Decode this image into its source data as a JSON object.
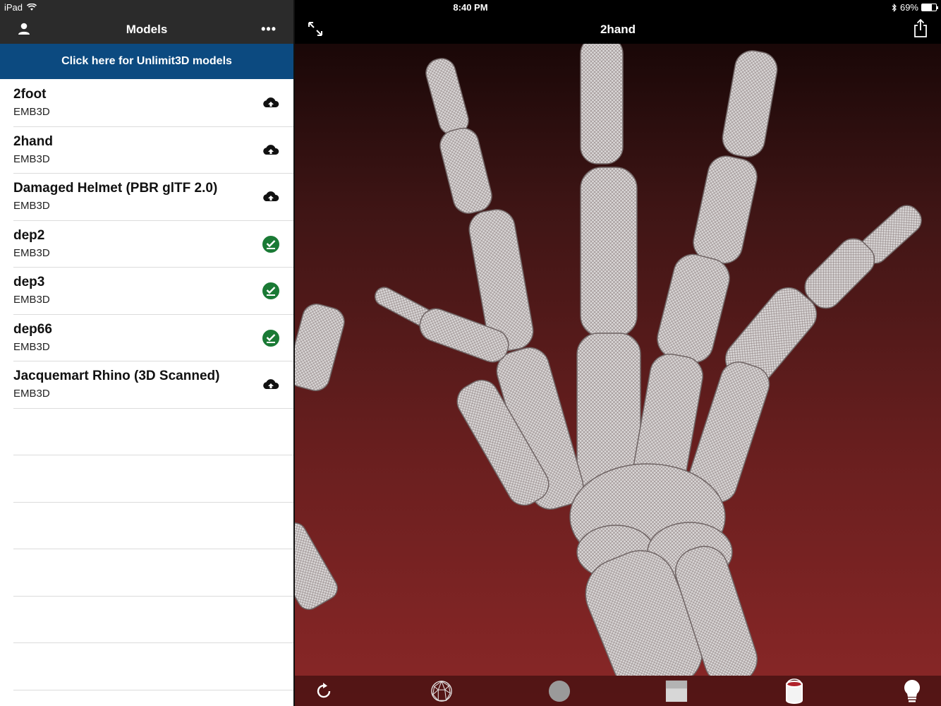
{
  "status_bar": {
    "device": "iPad",
    "time": "8:40 PM",
    "battery_label": "69%",
    "battery_level": 0.69
  },
  "left_nav": {
    "title": "Models",
    "more_label": "•••"
  },
  "promo_banner": {
    "label": "Click here for Unlimit3D models"
  },
  "models": [
    {
      "name": "2foot",
      "format": "EMB3D",
      "status": "cloud-upload-icon"
    },
    {
      "name": "2hand",
      "format": "EMB3D",
      "status": "cloud-upload-icon"
    },
    {
      "name": "Damaged Helmet (PBR glTF 2.0)",
      "format": "EMB3D",
      "status": "cloud-upload-icon"
    },
    {
      "name": "dep2",
      "format": "EMB3D",
      "status": "check-circle-icon"
    },
    {
      "name": "dep3",
      "format": "EMB3D",
      "status": "check-circle-icon"
    },
    {
      "name": "dep66",
      "format": "EMB3D",
      "status": "check-circle-icon"
    },
    {
      "name": "Jacquemart Rhino (3D Scanned)",
      "format": "EMB3D",
      "status": "cloud-upload-icon"
    }
  ],
  "viewer": {
    "title": "2hand"
  },
  "toolbar": [
    "rotate-icon",
    "wireframe-sphere-icon",
    "solid-sphere-icon",
    "texture-square-icon",
    "paint-bucket-icon",
    "lightbulb-icon"
  ],
  "colors": {
    "nav_bg": "#2b2b2b",
    "promo_bg": "#0c4a80",
    "check_green": "#1a7a35",
    "viewer_bg_bottom": "#8a2727"
  }
}
